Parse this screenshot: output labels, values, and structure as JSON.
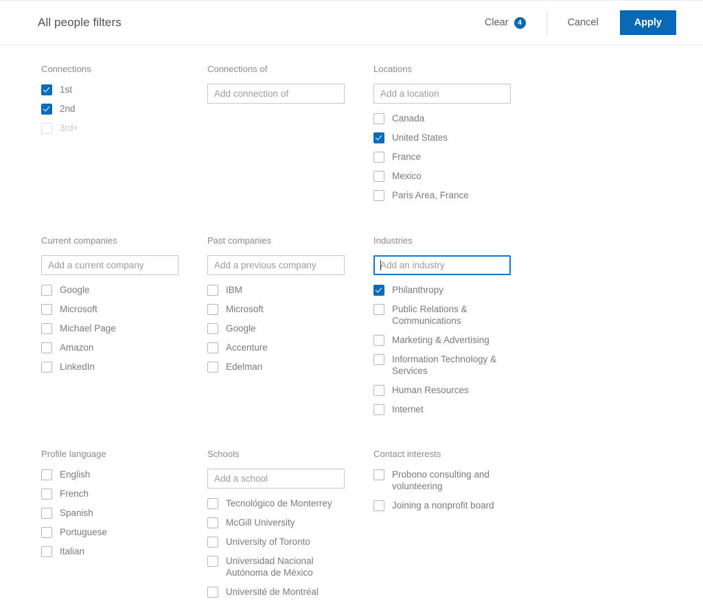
{
  "header": {
    "title": "All people filters",
    "clear_label": "Clear",
    "clear_count": "4",
    "cancel_label": "Cancel",
    "apply_label": "Apply",
    "accent_color": "#0a69b4"
  },
  "groups": {
    "connections": {
      "title": "Connections",
      "options": [
        {
          "label": "1st",
          "checked": true,
          "disabled": false
        },
        {
          "label": "2nd",
          "checked": true,
          "disabled": false
        },
        {
          "label": "3rd+",
          "checked": false,
          "disabled": true
        }
      ]
    },
    "connections_of": {
      "title": "Connections of",
      "placeholder": "Add connection of",
      "value": "",
      "options": []
    },
    "locations": {
      "title": "Locations",
      "placeholder": "Add a location",
      "value": "",
      "options": [
        {
          "label": "Canada",
          "checked": false
        },
        {
          "label": "United States",
          "checked": true
        },
        {
          "label": "France",
          "checked": false
        },
        {
          "label": "Mexico",
          "checked": false
        },
        {
          "label": "Paris Area, France",
          "checked": false
        }
      ]
    },
    "current_companies": {
      "title": "Current companies",
      "placeholder": "Add a current company",
      "value": "",
      "options": [
        {
          "label": "Google",
          "checked": false
        },
        {
          "label": "Microsoft",
          "checked": false
        },
        {
          "label": "Michael Page",
          "checked": false
        },
        {
          "label": "Amazon",
          "checked": false
        },
        {
          "label": "LinkedIn",
          "checked": false
        }
      ]
    },
    "past_companies": {
      "title": "Past companies",
      "placeholder": "Add a previous company",
      "value": "",
      "options": [
        {
          "label": "IBM",
          "checked": false
        },
        {
          "label": "Microsoft",
          "checked": false
        },
        {
          "label": "Google",
          "checked": false
        },
        {
          "label": "Accenture",
          "checked": false
        },
        {
          "label": "Edelman",
          "checked": false
        }
      ]
    },
    "industries": {
      "title": "Industries",
      "placeholder": "Add an industry",
      "value": "",
      "focused": true,
      "options": [
        {
          "label": "Philanthropy",
          "checked": true
        },
        {
          "label": "Public Relations & Communications",
          "checked": false
        },
        {
          "label": "Marketing & Advertising",
          "checked": false
        },
        {
          "label": "Information Technology & Services",
          "checked": false
        },
        {
          "label": "Human Resources",
          "checked": false
        },
        {
          "label": "Internet",
          "checked": false
        }
      ]
    },
    "profile_language": {
      "title": "Profile language",
      "options": [
        {
          "label": "English",
          "checked": false
        },
        {
          "label": "French",
          "checked": false
        },
        {
          "label": "Spanish",
          "checked": false
        },
        {
          "label": "Portuguese",
          "checked": false
        },
        {
          "label": "Italian",
          "checked": false
        }
      ]
    },
    "schools": {
      "title": "Schools",
      "placeholder": "Add a school",
      "value": "",
      "options": [
        {
          "label": "Tecnológico de Monterrey",
          "checked": false
        },
        {
          "label": "McGill University",
          "checked": false
        },
        {
          "label": "University of Toronto",
          "checked": false
        },
        {
          "label": "Universidad Nacional Autónoma de México",
          "checked": false
        },
        {
          "label": "Université de Montréal",
          "checked": false
        }
      ]
    },
    "contact_interests": {
      "title": "Contact interests",
      "options": [
        {
          "label": "Probono consulting and volunteering",
          "checked": false
        },
        {
          "label": "Joining a nonprofit board",
          "checked": false
        }
      ]
    }
  }
}
